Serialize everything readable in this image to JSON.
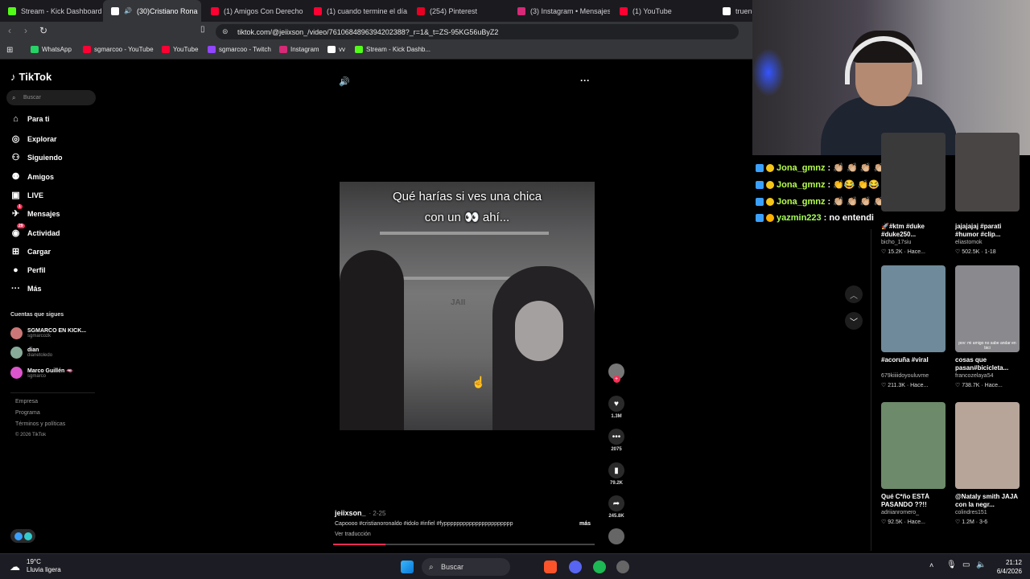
{
  "browser": {
    "tabs": [
      {
        "label": "Stream - Kick Dashboard",
        "color": "#53fc18",
        "active": false
      },
      {
        "label": "(30)Cristiano Rona",
        "color": "#ffffff",
        "active": true
      },
      {
        "label": "(1) Amigos Con Derecho",
        "color": "#ff0033",
        "active": false
      },
      {
        "label": "(1) cuando termine el día",
        "color": "#ff0033",
        "active": false
      },
      {
        "label": "(254) Pinterest",
        "color": "#e60023",
        "active": false
      },
      {
        "label": "(3) Instagram • Mensajes",
        "color": "#d62976",
        "active": false
      },
      {
        "label": "(1) YouTube",
        "color": "#ff0033",
        "active": false
      },
      {
        "label": "trueno",
        "color": "#ffffff",
        "active": false
      }
    ],
    "url": "tiktok.com/@jeiixson_/video/7610684896394202388?_r=1&_t=ZS-95KG56uByZ2",
    "bookmarks": [
      {
        "label": "WhatsApp",
        "color": "#25d366"
      },
      {
        "label": "sgmarcoo - YouTube",
        "color": "#ff0033"
      },
      {
        "label": "YouTube",
        "color": "#ff0033"
      },
      {
        "label": "sgmarcoo - Twitch",
        "color": "#9146ff"
      },
      {
        "label": "Instagram",
        "color": "#d62976"
      },
      {
        "label": "vv",
        "color": "#ffffff"
      },
      {
        "label": "Stream - Kick Dashb...",
        "color": "#53fc18"
      }
    ]
  },
  "tiktok": {
    "logo": "TikTok",
    "search_placeholder": "Buscar",
    "nav": [
      {
        "label": "Para ti",
        "icon": "home-icon",
        "glyph": "⌂"
      },
      {
        "label": "Explorar",
        "icon": "compass-icon",
        "glyph": "◎"
      },
      {
        "label": "Siguiendo",
        "icon": "following-icon",
        "glyph": "⚇"
      },
      {
        "label": "Amigos",
        "icon": "friends-icon",
        "glyph": "⚉"
      },
      {
        "label": "LIVE",
        "icon": "live-icon",
        "glyph": "▣"
      },
      {
        "label": "Mensajes",
        "icon": "messages-icon",
        "glyph": "✈",
        "badge": "1"
      },
      {
        "label": "Actividad",
        "icon": "activity-icon",
        "glyph": "◉",
        "badge": "29"
      },
      {
        "label": "Cargar",
        "icon": "upload-icon",
        "glyph": "⊞"
      },
      {
        "label": "Perfil",
        "icon": "profile-icon",
        "glyph": "●"
      },
      {
        "label": "Más",
        "icon": "more-icon",
        "glyph": "···"
      }
    ],
    "following_title": "Cuentas que sigues",
    "following": [
      {
        "name": "SGMARCO EN KICK...",
        "user": "sgmarcozk"
      },
      {
        "name": "dian",
        "user": "dianetoledo"
      },
      {
        "name": "Marco Guillén 🫦",
        "user": "sgmarco"
      }
    ],
    "footer": [
      "Empresa",
      "Programa",
      "Términos y políticas",
      "© 2026 TikTok"
    ],
    "video": {
      "caption_line1": "Qué harías si ves una chica",
      "caption_line2": "con un 👀 ahí...",
      "watermark": "JAII",
      "author": "jeiixson_",
      "date": "· 2-25",
      "tags": "Capoooo #cristianoronaldo #idolo #infiel #fypppppppppppppppppppppp",
      "more": "más",
      "translate": "Ver traducción",
      "progress": 0.2
    },
    "actions": {
      "likes": "1.3M",
      "comments": "2075",
      "saves": "79.2K",
      "shares": "245.8K"
    },
    "grid": [
      {
        "caption": "🚀#ktm #duke #duke250...",
        "user": "bicho_17siu",
        "stat": "15.2K · Hace...",
        "color": "#3a3a3a"
      },
      {
        "caption": "jajajajaj #parati #humor #clip...",
        "user": "eliastomok",
        "stat": "502.5K · 1-18",
        "color": "#4a4545"
      },
      {
        "caption": "#acoruña #viral",
        "user": "679kiiiidoyouluvme",
        "stat": "211.3K · Hace...",
        "color": "#6f8a9a"
      },
      {
        "caption": "cosas que pasan#bicicleta...",
        "user": "francozelaya54",
        "stat": "738.7K · Hace...",
        "color": "#8a8a8e"
      },
      {
        "caption": "Qué C*ño ESTÁ PASANDO ??!!",
        "user": "adriianromero_",
        "stat": "92.5K · Hace...",
        "color": "#6d8a6a"
      },
      {
        "caption": "@Nataly smith JAJA con la negr...",
        "user": "colindres151",
        "stat": "1.2M · 3-6",
        "color": "#b8a59a"
      }
    ],
    "thumb_text": "pov: mi amigo no sabe andar en bici"
  },
  "chat": [
    {
      "user": "Jona_gmnz",
      "message": ":  👏🏼 👏🏼 👏🏼 👏🏼",
      "color": "#b7ff4a"
    },
    {
      "user": "Jona_gmnz",
      "message": ":  👏😂 👏😂 👏😂 👏😂",
      "color": "#b7ff4a"
    },
    {
      "user": "Jona_gmnz",
      "message": ":  👏🏼 👏🏼 👏🏼 👏🏼",
      "color": "#b7ff4a"
    },
    {
      "user": "yazmin223",
      "message": ": no entendi",
      "color": "#a6ff5a"
    }
  ],
  "taskbar": {
    "temp": "19°C",
    "weather": "Lluvia ligera",
    "search": "Buscar",
    "time": "21:12",
    "date": "6/4/2026"
  }
}
